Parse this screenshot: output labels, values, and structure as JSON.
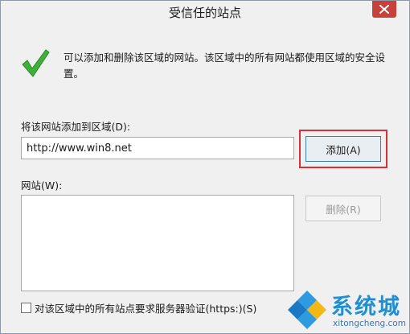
{
  "window": {
    "title": "受信任的站点"
  },
  "info": {
    "text": "可以添加和删除该区域的网站。该区域中的所有网站都使用区域的安全设置。"
  },
  "add_section": {
    "label": "将该网站添加到区域(D):",
    "url_value": "http://www.win8.net",
    "add_button": "添加(A)"
  },
  "sites_section": {
    "label": "网站(W):",
    "items": [],
    "remove_button": "删除(R)"
  },
  "https": {
    "label": "对该区域中的所有站点要求服务器验证(https:)(S)",
    "checked": false
  },
  "watermark": {
    "brand": "系统城",
    "url": "xitongcheng.com"
  },
  "colors": {
    "close": "#c7403a",
    "highlight": "#d9313a",
    "accent": "#3c7fb1",
    "brand": "#1f8fd1"
  },
  "icons": {
    "check": "check-icon",
    "close": "close-icon",
    "logo": "xitongcheng-logo"
  }
}
